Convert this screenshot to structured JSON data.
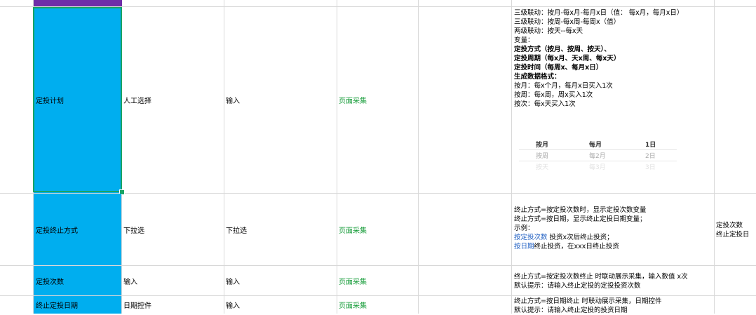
{
  "rows": [
    {
      "name": "定投计划",
      "ui_type": "人工选择",
      "input_type": "输入",
      "source": "页面采集",
      "desc_lines": [
        {
          "text": "三级联动：按月-每x月-每月x日（值：  每x月，每月x日）",
          "style": "normal"
        },
        {
          "text": "三级联动：按周-每x周-每周x（值）",
          "style": "normal"
        },
        {
          "text": "两级联动：按天--每x天",
          "style": "normal"
        },
        {
          "text": "变量：",
          "style": "normal"
        },
        {
          "text": "定投方式（按月、按周、按天）、",
          "style": "bold"
        },
        {
          "text": "定投周期（每x月、天x周、每x天）",
          "style": "bold"
        },
        {
          "text": "定投时间（每周x、每月x日）",
          "style": "bold"
        },
        {
          "text": "生成数据格式：",
          "style": "bold"
        },
        {
          "text": "按月：每x个月，每月x日买入1次",
          "style": "normal"
        },
        {
          "text": "按周：每x周，周x买入1次",
          "style": "normal"
        },
        {
          "text": "按次：每x天买入1次",
          "style": "normal"
        }
      ],
      "picker": [
        [
          "按月",
          "每月",
          "1日"
        ],
        [
          "按周",
          "每2月",
          "2日"
        ],
        [
          "按天",
          "每3月",
          "3日"
        ]
      ]
    },
    {
      "name": "定投终止方式",
      "ui_type": "下拉选",
      "input_type": "下拉选",
      "source": "页面采集",
      "desc_lines": [
        {
          "text": "终止方式=按定投次数时，显示定投次数变量",
          "style": "normal"
        },
        {
          "text": "终止方式=按日期，显示终止定投日期变量；",
          "style": "normal"
        },
        {
          "text": "示例：",
          "style": "normal"
        }
      ],
      "desc_link1": "按定投次数",
      "desc_tail1": " 投资x次后终止投资；",
      "desc_link2": "按日期",
      "desc_tail2": "终止投资，在xxx日终止投资",
      "extra_lines": [
        "定投次数",
        "终止定投日"
      ]
    },
    {
      "name": "定投次数",
      "ui_type": "输入",
      "input_type": "输入",
      "source": "页面采集",
      "desc_lines": [
        {
          "text": "终止方式=按定投次数终止 时联动展示采集，输入数值 x次",
          "style": "normal"
        },
        {
          "text": "默认提示：请输入终止定投的定投投资次数",
          "style": "normal"
        }
      ]
    },
    {
      "name": "终止定投日期",
      "ui_type": "日期控件",
      "input_type": "输入",
      "source": "页面采集",
      "desc_lines": [
        {
          "text": "终止方式=按日期终止 时联动展示采集，日期控件",
          "style": "normal"
        },
        {
          "text": "默认提示：请输入终止定投的投资日期",
          "style": "normal"
        }
      ]
    }
  ],
  "colors": {
    "name_fill": "#00aeef",
    "header_fill": "#6f2da8",
    "source_text": "#1a9e3c",
    "link_text": "#2563c4",
    "selection": "#1aa464"
  }
}
